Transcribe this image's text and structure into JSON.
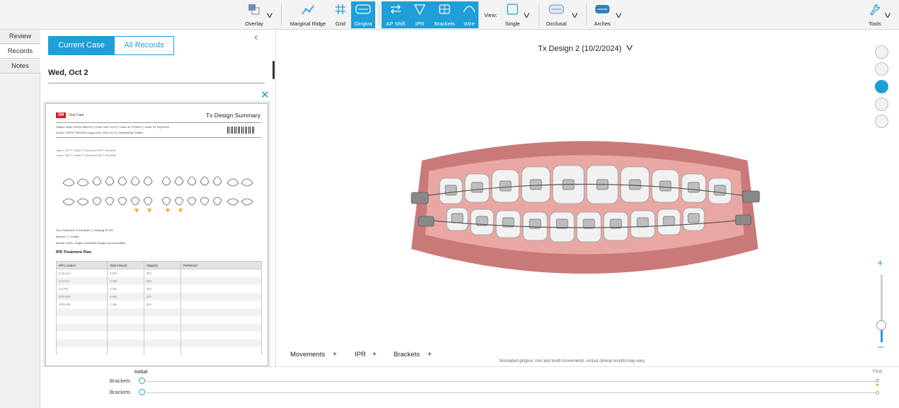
{
  "toolbar": {
    "overlay": "Overlay",
    "marginal_ridge": "Marginal Ridge",
    "grid": "Grid",
    "gingiva": "Gingiva",
    "ap_shift": "AP Shift",
    "ipr": "IPR",
    "brackets": "Brackets",
    "wire": "Wire",
    "view_label": "View:",
    "single": "Single",
    "occlusal": "Occlusal",
    "arches": "Arches",
    "tools": "Tools",
    "accent_color": "#1f9ed8"
  },
  "side_tabs": [
    "Review",
    "Records",
    "Notes"
  ],
  "panel": {
    "current_case": "Current Case",
    "all_records": "All Records",
    "date": "Wed, Oct 2"
  },
  "document": {
    "brand": "3M",
    "brand_sub": "Oral Care",
    "title": "Tx Design Summary",
    "patient_line": "Patient: ANA LOPEZ MAGSO  |  DOB: 2007-11-07  |  Case ID: PT55CX  |  Order ID: DQ29402",
    "doctor_line": "Doctor: DRES TRAVESI  |  Approved: 2024-10-02  |  Numbering: Palmer",
    "upper": "Upper: 3M™ Clarity™ Advanced 3M™ Brackets",
    "lower": "Lower: 3M™ Clarity™ Advanced 3M™ Brackets",
    "legend1": "Key:  Extracted  ✕ Extracted  ▢ Missing  ▼ IPR",
    "legend2": "Bracket:  ▢ Clarity",
    "legend3": "Buccal Tubes:  Single convertible   Single non-convertible",
    "ipr_title": "IPR Treatment Plan",
    "ipr_headers": [
      "IPR Location",
      "Total Amount",
      "Stage(s)",
      "Performed"
    ],
    "ipr_rows": [
      [
        "LL3-LL4",
        "4 mm",
        "N/A",
        ""
      ],
      [
        "LL2-LL1",
        "4 mm",
        "N/A",
        ""
      ],
      [
        "LL1-R1",
        "4 mm",
        "N/A",
        ""
      ],
      [
        "LR1-LR2",
        "4 mm",
        "N/A",
        ""
      ],
      [
        "LR3-LR4",
        "4 mm",
        "N/A",
        ""
      ],
      [
        "",
        "",
        "",
        ""
      ],
      [
        "",
        "",
        "",
        ""
      ],
      [
        "",
        "",
        "",
        ""
      ],
      [
        "",
        "",
        "",
        ""
      ],
      [
        "",
        "",
        "",
        ""
      ],
      [
        "",
        "",
        "",
        ""
      ]
    ]
  },
  "viewer": {
    "title": "Tx Design 2 (10/2/2024)",
    "bottom_tabs": [
      "Movements",
      "IPR",
      "Brackets"
    ],
    "disclaimer": "Simulated gingiva, root and tooth movements. Actual clinical results may vary.",
    "zoom_level": 0.25
  },
  "timeline": {
    "initial": "Initial",
    "final": "Final",
    "rows": [
      "Brackets",
      "Brackets"
    ]
  }
}
